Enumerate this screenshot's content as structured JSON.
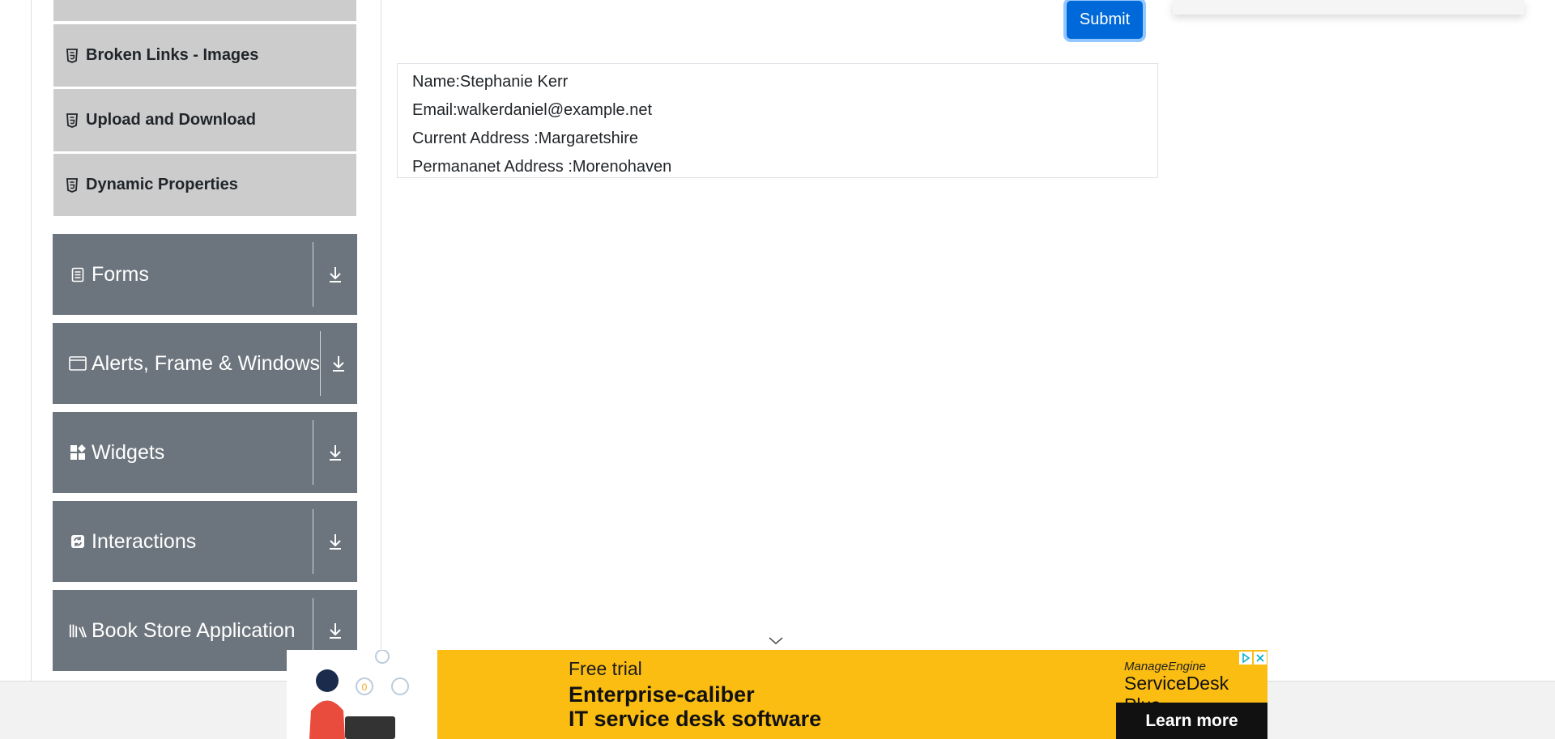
{
  "sidebar": {
    "sub_items": [
      {
        "label": ""
      },
      {
        "label": "Broken Links - Images"
      },
      {
        "label": "Upload and Download"
      },
      {
        "label": "Dynamic Properties"
      }
    ],
    "groups": [
      {
        "label": "Forms",
        "icon": "document-icon"
      },
      {
        "label": "Alerts, Frame & Windows",
        "icon": "window-icon"
      },
      {
        "label": "Widgets",
        "icon": "widgets-icon"
      },
      {
        "label": "Interactions",
        "icon": "interactions-icon"
      },
      {
        "label": "Book Store Application",
        "icon": "books-icon"
      }
    ]
  },
  "form": {
    "submit_label": "Submit"
  },
  "output": {
    "name": "Name:Stephanie Kerr",
    "email": "Email:walkerdaniel@example.net",
    "current_address": "Current Address :Margaretshire",
    "permanent_address": "Permananet Address :Morenohaven"
  },
  "ad": {
    "free_trial": "Free trial",
    "headline_1": "Enterprise-caliber",
    "headline_2": "IT service desk software",
    "brand_small": "ManageEngine",
    "brand_big": "ServiceDesk Plus",
    "cta": "Learn more"
  },
  "colors": {
    "primary": "#0069d9",
    "sidebar_group": "#6c757d",
    "sidebar_item": "#cccccc",
    "ad_background": "#fbbd12"
  }
}
